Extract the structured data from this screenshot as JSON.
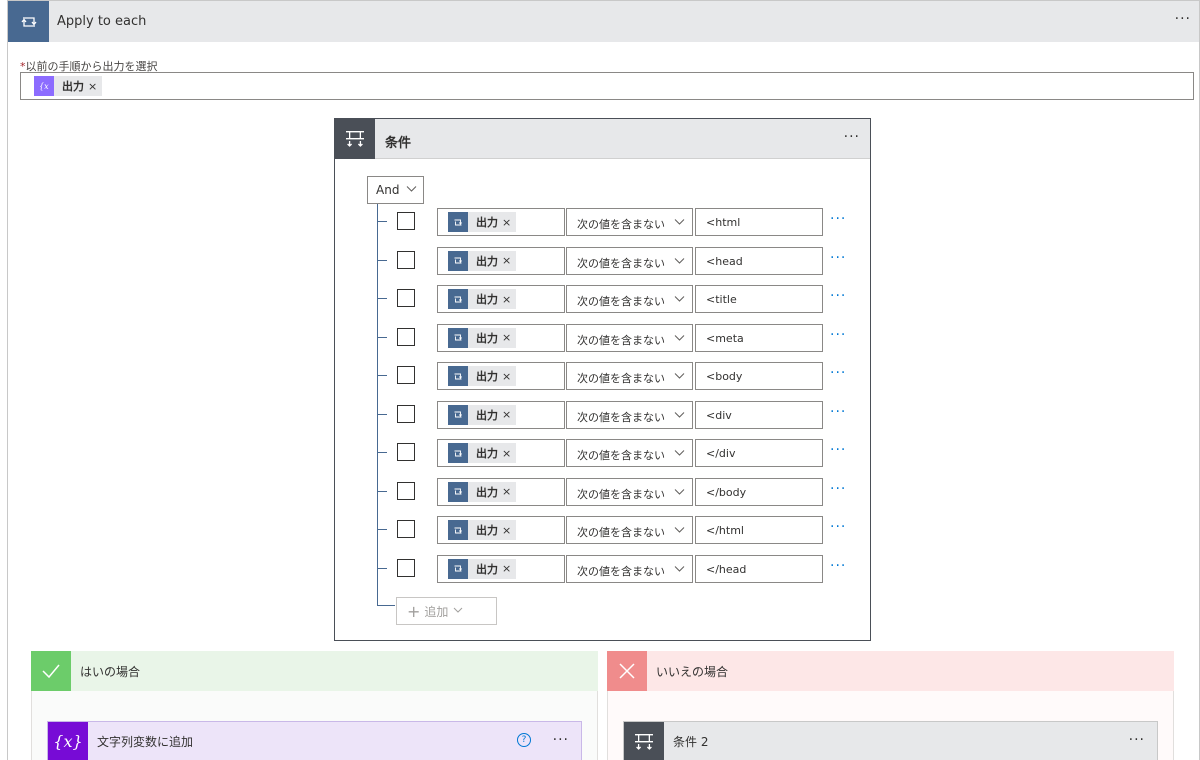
{
  "apply_each": {
    "title": "Apply to each",
    "more": "···",
    "select_label": "以前の手順から出力を選択",
    "required_mark": "*",
    "token_label": "出力",
    "token_remove": "×"
  },
  "condition": {
    "title": "条件",
    "more": "···",
    "group_operator": "And",
    "rows": [
      {
        "left_token": "出力",
        "remove": "×",
        "operator": "次の値を含まない",
        "value": "<html",
        "more": "···"
      },
      {
        "left_token": "出力",
        "remove": "×",
        "operator": "次の値を含まない",
        "value": "<head",
        "more": "···"
      },
      {
        "left_token": "出力",
        "remove": "×",
        "operator": "次の値を含まない",
        "value": "<title",
        "more": "···"
      },
      {
        "left_token": "出力",
        "remove": "×",
        "operator": "次の値を含まない",
        "value": "<meta",
        "more": "···"
      },
      {
        "left_token": "出力",
        "remove": "×",
        "operator": "次の値を含まない",
        "value": "<body",
        "more": "···"
      },
      {
        "left_token": "出力",
        "remove": "×",
        "operator": "次の値を含まない",
        "value": "<div",
        "more": "···"
      },
      {
        "left_token": "出力",
        "remove": "×",
        "operator": "次の値を含まない",
        "value": "</div",
        "more": "···"
      },
      {
        "left_token": "出力",
        "remove": "×",
        "operator": "次の値を含まない",
        "value": "</body",
        "more": "···"
      },
      {
        "left_token": "出力",
        "remove": "×",
        "operator": "次の値を含まない",
        "value": "</html",
        "more": "···"
      },
      {
        "left_token": "出力",
        "remove": "×",
        "operator": "次の値を含まない",
        "value": "</head",
        "more": "···"
      }
    ],
    "add_label": "追加"
  },
  "yes_branch": {
    "title": "はいの場合",
    "action": {
      "title": "文字列変数に追加",
      "icon_text": "{x}",
      "help": "?",
      "more": "···"
    }
  },
  "no_branch": {
    "title": "いいえの場合",
    "action": {
      "title": "条件 2",
      "more": "···"
    }
  },
  "colors": {
    "loop_accent": "#486991",
    "condition_accent": "#4a4f57",
    "variable_accent": "#770bd6",
    "yes_accent": "#6ccc6a",
    "no_accent": "#f08c8c",
    "link_blue": "#0078d4"
  }
}
